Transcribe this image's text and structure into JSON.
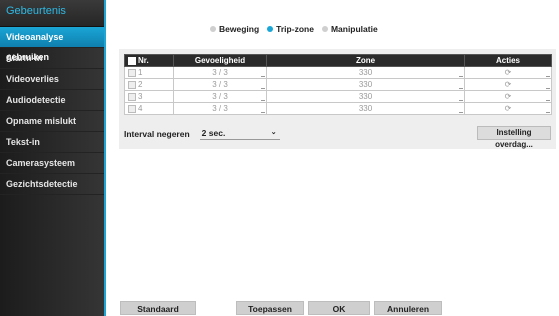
{
  "sidebar": {
    "title": "Gebeurtenis",
    "items": [
      {
        "label": "Videoanalyse gebruiken",
        "active": true
      },
      {
        "label": "Alarm-in"
      },
      {
        "label": "Videoverlies"
      },
      {
        "label": "Audiodetectie"
      },
      {
        "label": "Opname mislukt"
      },
      {
        "label": "Tekst-in"
      },
      {
        "label": "Camerasysteem"
      },
      {
        "label": "Gezichtsdetectie"
      }
    ]
  },
  "modes": [
    {
      "label": "Beweging",
      "selected": false
    },
    {
      "label": "Trip-zone",
      "selected": true
    },
    {
      "label": "Manipulatie",
      "selected": false
    }
  ],
  "table": {
    "headers": [
      "Nr.",
      "Gevoeligheid",
      "Zone",
      "Acties"
    ],
    "rows": [
      {
        "nr": "1",
        "gevoeligheid": "3 / 3",
        "zone": "330",
        "actie": "⟳"
      },
      {
        "nr": "2",
        "gevoeligheid": "3 / 3",
        "zone": "330",
        "actie": "⟳"
      },
      {
        "nr": "3",
        "gevoeligheid": "3 / 3",
        "zone": "330",
        "actie": "⟳"
      },
      {
        "nr": "4",
        "gevoeligheid": "3 / 3",
        "zone": "330",
        "actie": "⟳"
      }
    ]
  },
  "interval": {
    "label": "Interval negeren",
    "value": "2 sec."
  },
  "overdag_button": "Instelling overdag...",
  "buttons": {
    "standaard": "Standaard",
    "toepassen": "Toepassen",
    "ok": "OK",
    "annuleren": "Annuleren"
  },
  "colors": {
    "accent": "#1aa6d6",
    "sidebar_bg": "#2b2b2b"
  }
}
